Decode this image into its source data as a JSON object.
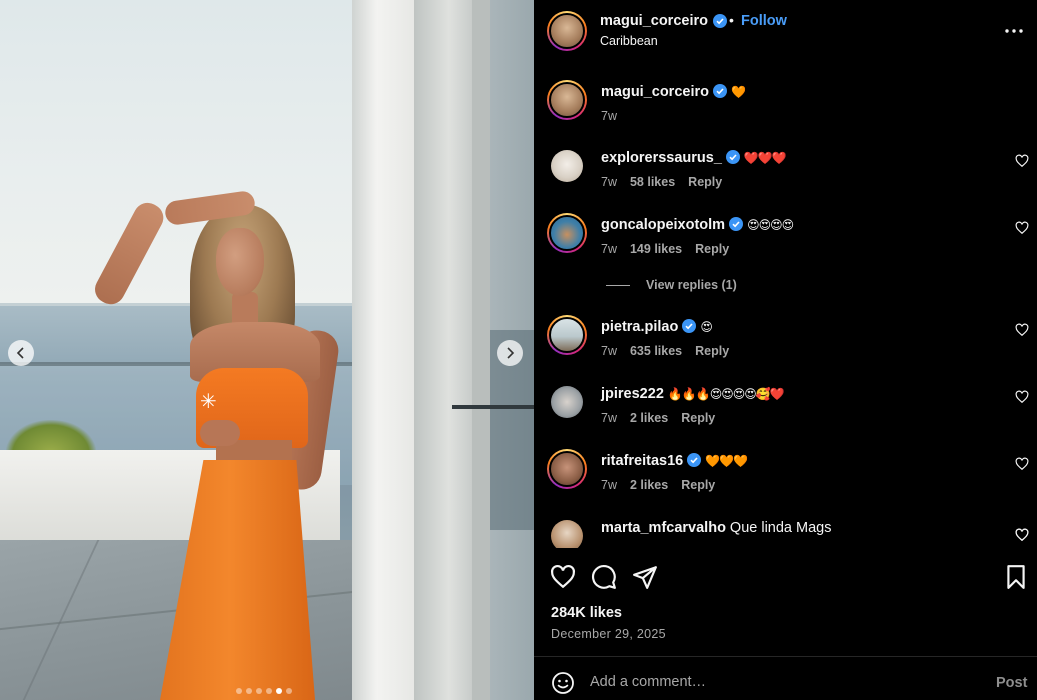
{
  "post": {
    "carousel": {
      "slide_count": 6,
      "active_index": 4
    },
    "author": {
      "username": "magui_corceiro",
      "verified": true,
      "follow_label": "Follow",
      "separator": "•",
      "location": "Caribbean"
    },
    "caption": {
      "username": "magui_corceiro",
      "text": "🧡",
      "time": "7w"
    },
    "comments": [
      {
        "username": "explorerssaurus_",
        "verified": true,
        "text": "❤️❤️❤️",
        "time": "7w",
        "likes": "58 likes",
        "reply_label": "Reply"
      },
      {
        "username": "goncalopeixotolm",
        "verified": true,
        "text": "😍😍😍😍",
        "time": "7w",
        "likes": "149 likes",
        "reply_label": "Reply"
      },
      {
        "username": "pietra.pilao",
        "verified": true,
        "text": "😍",
        "time": "7w",
        "likes": "635 likes",
        "reply_label": "Reply"
      },
      {
        "username": "jpires222",
        "verified": false,
        "text": "🔥🔥🔥😍😍😍😍🥰❤️",
        "time": "7w",
        "likes": "2 likes",
        "reply_label": "Reply"
      },
      {
        "username": "ritafreitas16",
        "verified": true,
        "text": "🧡🧡🧡",
        "time": "7w",
        "likes": "2 likes",
        "reply_label": "Reply"
      },
      {
        "username": "marta_mfcarvalho",
        "verified": false,
        "text": "Que linda Mags",
        "time": "",
        "likes": "",
        "reply_label": ""
      }
    ],
    "view_replies_label": "View replies (1)",
    "likes_total": "284K likes",
    "date": "December 29, 2025",
    "add_comment": {
      "placeholder": "Add a comment…",
      "post_label": "Post"
    }
  },
  "colors": {
    "background": "#000000",
    "text_primary": "#f5f5f5",
    "text_secondary": "#a8a8a8",
    "follow_blue": "#4a9df8",
    "verified_blue": "#3b95f6",
    "dress_orange": "#f07a24"
  },
  "icons": {
    "more": "more-horizontal-icon",
    "heart": "heart-outline-icon",
    "comment": "comment-bubble-icon",
    "share": "paper-plane-icon",
    "save": "bookmark-icon",
    "emoji": "smiley-icon",
    "verified": "verified-badge-icon",
    "prev": "chevron-left-icon",
    "next": "chevron-right-icon"
  }
}
